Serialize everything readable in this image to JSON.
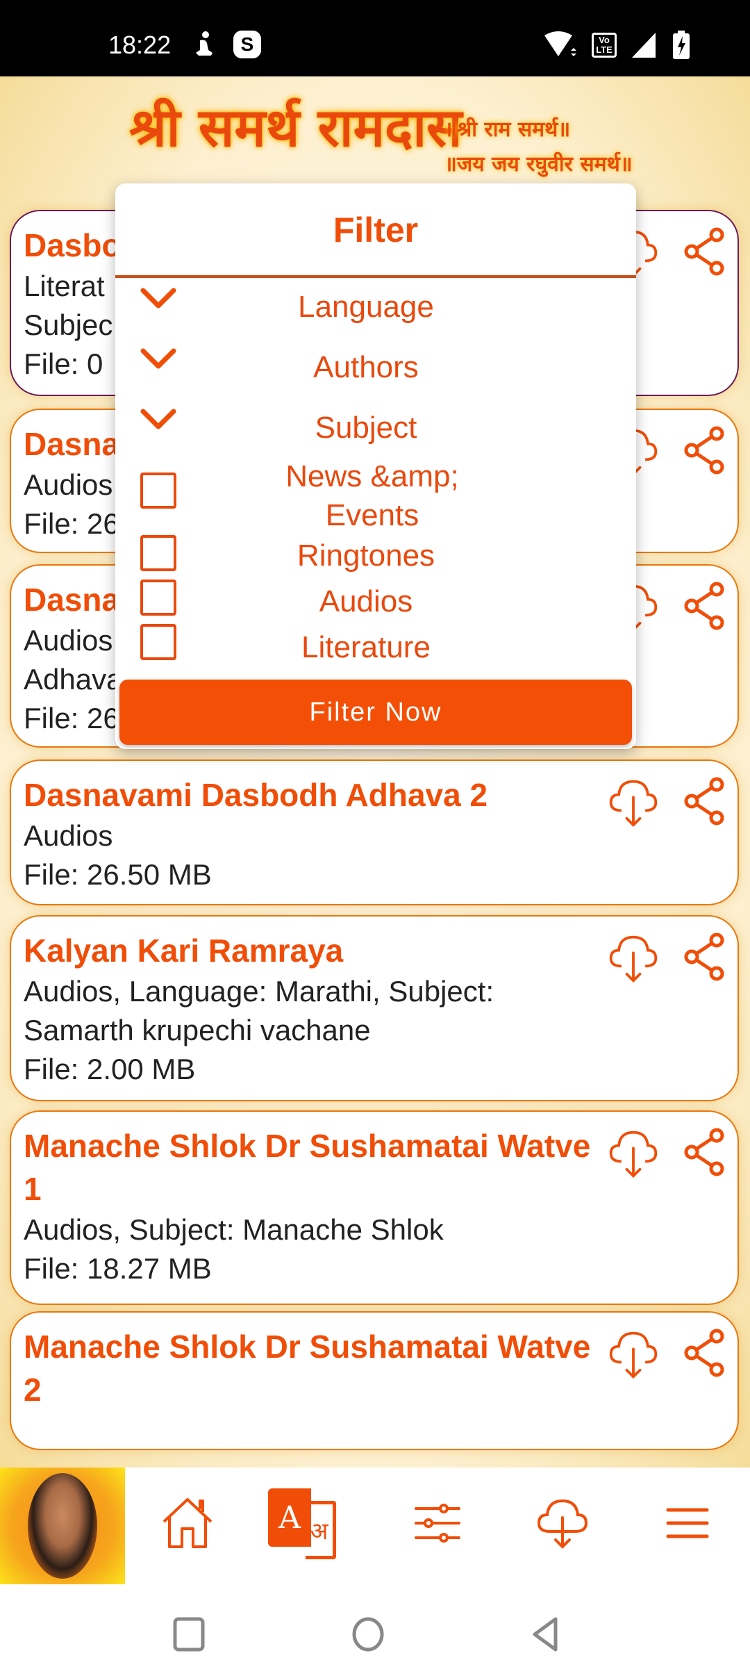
{
  "status_bar": {
    "time": "18:22",
    "left_icons": [
      "accessibility-icon",
      "skype-icon"
    ],
    "skype_glyph": "S",
    "right_icons": [
      "wifi-icon",
      "volte-icon",
      "signal-icon",
      "battery-charging-icon"
    ],
    "volte_label_1": "Vo",
    "volte_label_2": "LTE"
  },
  "banner": {
    "main": "श्री समर्थ रामदास",
    "sub1": "॥श्री राम समर्थ॥",
    "sub2": "॥जय जय रघुवीर समर्थ॥"
  },
  "toolbar": {
    "back_icon": "arrow-left-icon",
    "search_icon": "search-icon"
  },
  "colors": {
    "accent": "#f04e08",
    "button": "#f44f06",
    "text": "#222222",
    "background": "#fdf1d6"
  },
  "items": [
    {
      "title": "Dasbo",
      "meta_lines": [
        "Literat",
        "Subjec"
      ],
      "file": "File: 0"
    },
    {
      "title": "Dasna",
      "meta_lines": [
        "Audios"
      ],
      "file": "File: 26"
    },
    {
      "title": "Dasna",
      "meta_lines": [
        "Audios",
        "Adhava"
      ],
      "file": "File: 26.50 MB"
    },
    {
      "title": "Dasnavami Dasbodh Adhava 2",
      "meta_lines": [
        "Audios"
      ],
      "file": "File: 26.50 MB"
    },
    {
      "title": "Kalyan Kari Ramraya",
      "meta_lines": [
        "Audios, Language: Marathi, Subject:",
        "Samarth krupechi vachane"
      ],
      "file": "File: 2.00 MB"
    },
    {
      "title": "Manache Shlok Dr Sushamatai Watve 1",
      "meta_lines": [
        "Audios, Subject: Manache Shlok"
      ],
      "file": "File: 18.27 MB"
    },
    {
      "title": "Manache Shlok Dr Sushamatai Watve 2",
      "meta_lines": [],
      "file": ""
    }
  ],
  "filter": {
    "title": "Filter",
    "dropdowns": [
      {
        "label": "Language"
      },
      {
        "label": "Authors"
      },
      {
        "label": "Subject"
      }
    ],
    "checkboxes": [
      {
        "label": "News &amp; Events",
        "checked": false
      },
      {
        "label": "Ringtones",
        "checked": false
      },
      {
        "label": "Audios",
        "checked": false
      },
      {
        "label": "Literature",
        "checked": false
      }
    ],
    "submit_label": "Filter Now"
  },
  "bottom_nav": {
    "items": [
      "avatar",
      "home-icon",
      "translate-icon",
      "filter-sliders-icon",
      "download-icon",
      "menu-icon"
    ],
    "translate_a": "A",
    "translate_b": "अ"
  },
  "system_nav": [
    "recents-button",
    "home-button",
    "back-button"
  ]
}
